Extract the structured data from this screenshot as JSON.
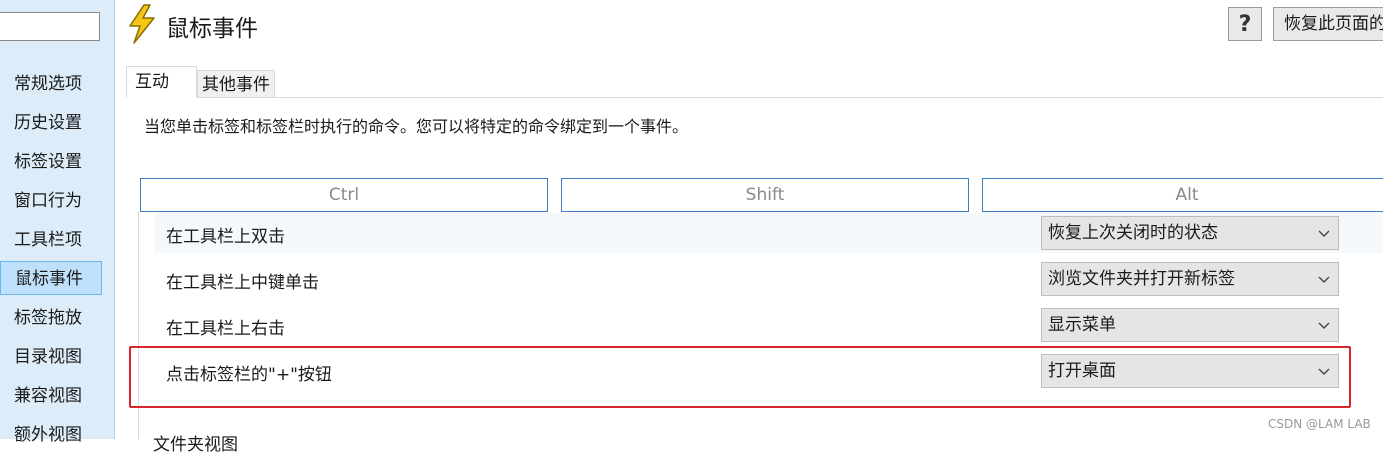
{
  "sidebar": {
    "items": [
      {
        "label": "常规选项"
      },
      {
        "label": "历史设置"
      },
      {
        "label": "标签设置"
      },
      {
        "label": "窗口行为"
      },
      {
        "label": "工具栏项"
      },
      {
        "label": "鼠标事件",
        "active": true
      },
      {
        "label": "标签拖放"
      },
      {
        "label": "目录视图"
      },
      {
        "label": "兼容视图"
      },
      {
        "label": "额外视图"
      }
    ]
  },
  "header": {
    "icon": "lightning-icon",
    "title": "鼠标事件",
    "help_label": "?",
    "restore_label": "恢复此页面的"
  },
  "tabs": [
    {
      "label": "互动",
      "active": true
    },
    {
      "label": "其他事件",
      "active": false
    }
  ],
  "description": "当您单击标签和标签栏时执行的命令。您可以将特定的命令绑定到一个事件。",
  "modifiers": [
    "Ctrl",
    "Shift",
    "Alt"
  ],
  "events": [
    {
      "label": "在工具栏上双击",
      "value": "恢复上次关闭时的状态"
    },
    {
      "label": "在工具栏上中键单击",
      "value": "浏览文件夹并打开新标签"
    },
    {
      "label": "在工具栏上右击",
      "value": "显示菜单"
    },
    {
      "label": "点击标签栏的\"+\"按钮",
      "value": "打开桌面"
    }
  ],
  "bottom_label": "文件夹视图",
  "watermark": "CSDN @LAM LAB",
  "colors": {
    "accent": "#3e7bbf",
    "highlight": "#d6262e",
    "sidebar_bg": "#dcecf9"
  }
}
